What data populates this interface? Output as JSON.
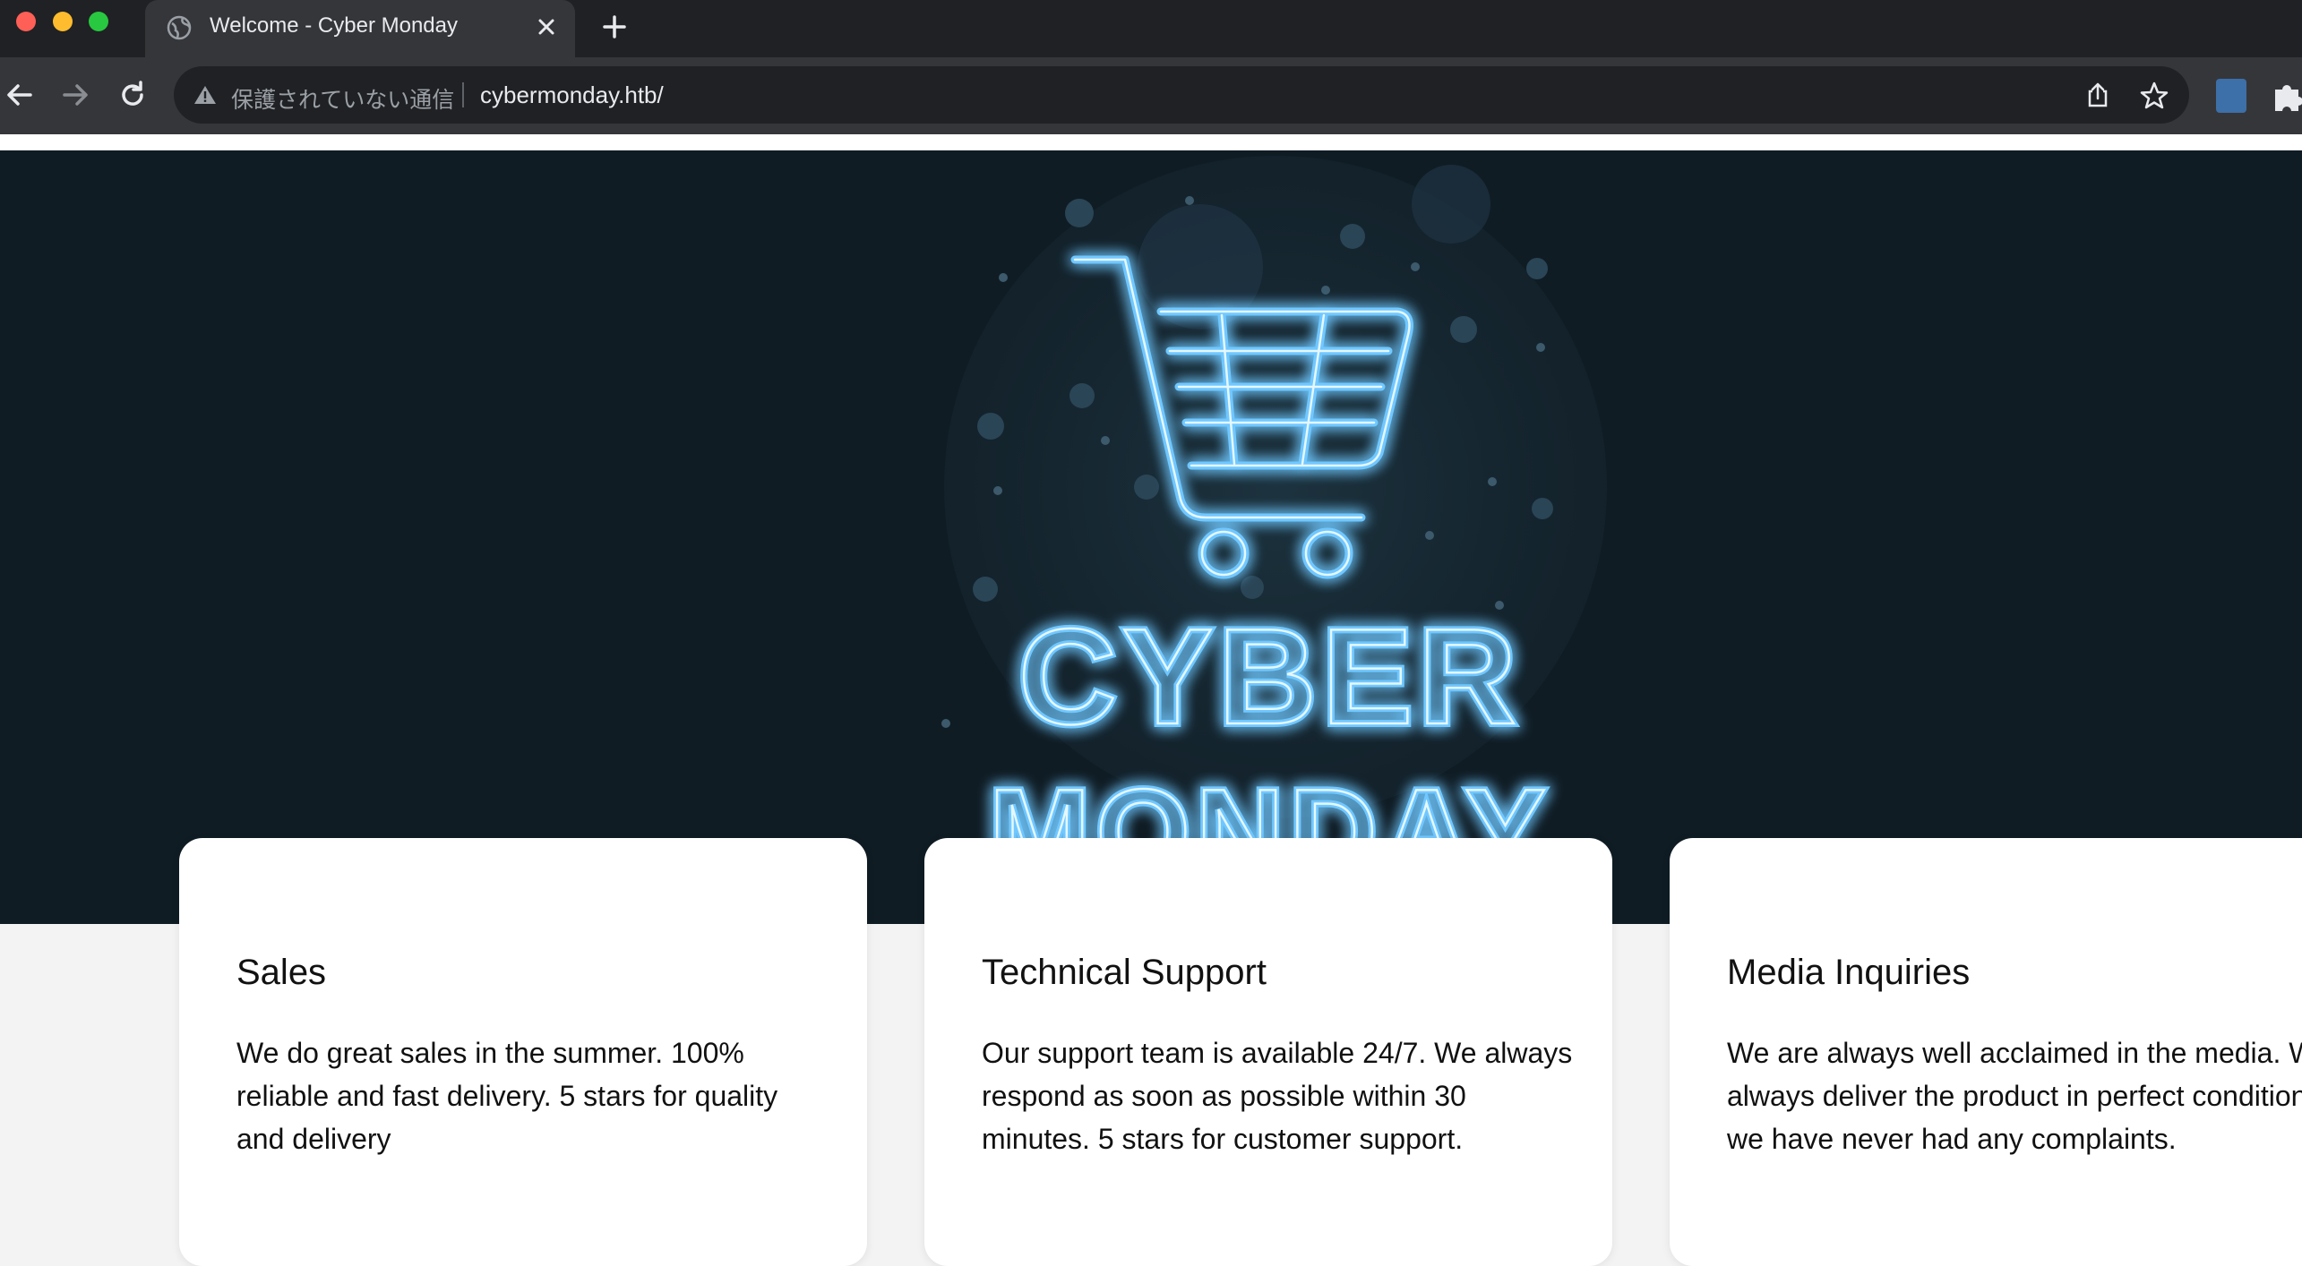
{
  "browser": {
    "tab": {
      "title": "Welcome - Cyber Monday",
      "favicon": "globe-icon"
    },
    "new_tab": "plus-icon",
    "omnibox": {
      "security_label": "保護されていない通信",
      "url": "cybermonday.htb/"
    },
    "colors": {
      "chrome_dark": "#202124",
      "chrome_mid": "#35363a"
    }
  },
  "hero": {
    "line1": "CYBER",
    "line2": "MONDAY",
    "icon": "shopping-cart-neon",
    "colors": {
      "background": "#101c24",
      "neon": "#6fc8ff"
    }
  },
  "cards": [
    {
      "title": "Sales",
      "text": "We do great sales in the summer. 100% reliable and fast delivery. 5 stars for quality and delivery"
    },
    {
      "title": "Technical Support",
      "text": "Our support team is available 24/7. We always respond as soon as possible within 30 minutes. 5 stars for customer support."
    },
    {
      "title": "Media Inquiries",
      "text": "We are always well acclaimed in the media. We always deliver the product in perfect condition and we have never had any complaints."
    }
  ]
}
